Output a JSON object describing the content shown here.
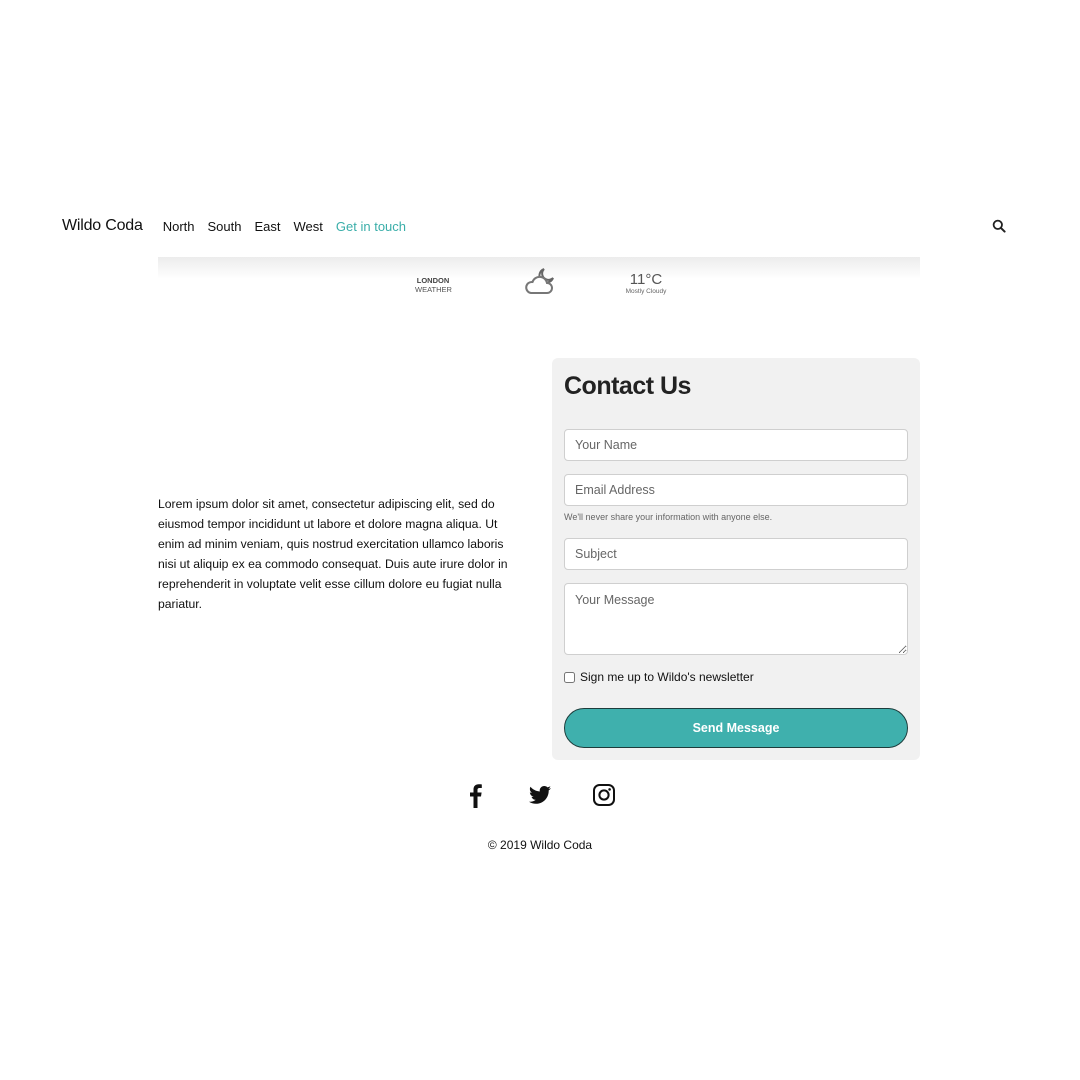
{
  "nav": {
    "brand": "Wildo Coda",
    "links": [
      "North",
      "South",
      "East",
      "West",
      "Get in touch"
    ],
    "search_icon": "search-icon"
  },
  "weather": {
    "city": "LONDON",
    "label": "WEATHER",
    "icon": "partly-cloudy-night-icon",
    "temperature": "11°C",
    "condition": "Mostly Cloudy"
  },
  "main": {
    "lorem": "Lorem ipsum dolor sit amet, consectetur adipiscing elit, sed do eiusmod tempor incididunt ut labore et dolore magna aliqua. Ut enim ad minim veniam, quis nostrud exercitation ullamco laboris nisi ut aliquip ex ea commodo consequat. Duis aute irure dolor in reprehenderit in voluptate velit esse cillum dolore eu fugiat nulla pariatur."
  },
  "contact": {
    "title": "Contact Us",
    "name_placeholder": "Your Name",
    "email_placeholder": "Email Address",
    "email_hint": "We'll never share your information with anyone else.",
    "subject_placeholder": "Subject",
    "message_placeholder": "Your Message",
    "newsletter_label": "Sign me up to Wildo's newsletter",
    "send_label": "Send Message"
  },
  "footer": {
    "social_icons": [
      "facebook-icon",
      "twitter-icon",
      "instagram-icon"
    ],
    "copyright": "© 2019 Wildo Coda"
  },
  "colors": {
    "accent": "#3aaea9",
    "button": "#3fb0ad",
    "card_background": "#f1f1f1"
  }
}
